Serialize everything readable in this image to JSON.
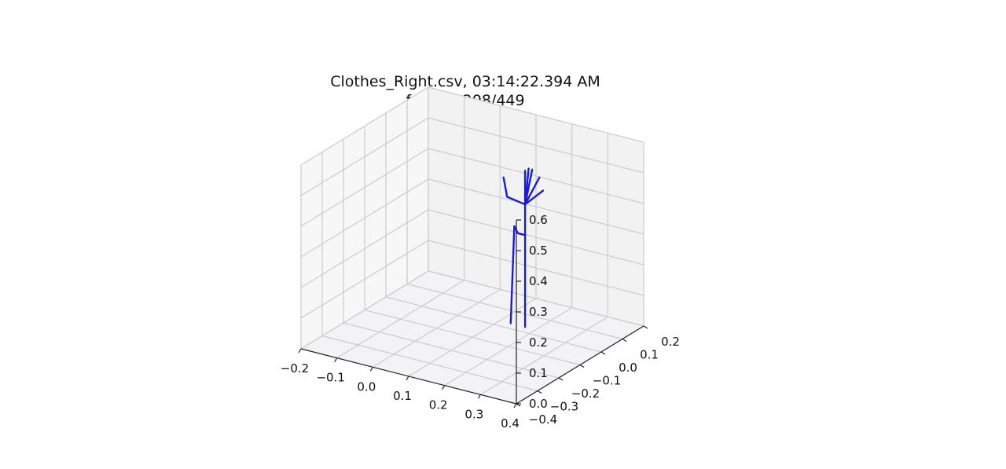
{
  "chart_data": {
    "type": "line",
    "projection": "3d",
    "title": "Clothes_Right.csv, 03:14:22.394 AM",
    "subtitle": "frame=208/449",
    "xlabel": "",
    "ylabel": "",
    "zlabel": "",
    "x_ticks": [
      "−0.2",
      "−0.1",
      "0.0",
      "0.1",
      "0.2",
      "0.3",
      "0.4"
    ],
    "y_ticks": [
      "−0.4",
      "−0.3",
      "−0.2",
      "−0.1",
      "0.0",
      "0.1",
      "0.2"
    ],
    "z_ticks": [
      "0.0",
      "0.1",
      "0.2",
      "0.3",
      "0.4",
      "0.5",
      "0.6"
    ],
    "xlim": [
      -0.2,
      0.4
    ],
    "ylim": [
      -0.4,
      0.2
    ],
    "zlim": [
      0.0,
      0.6
    ],
    "grid": true,
    "pane_color": "#f2f2f2",
    "grid_color": "#cccccc",
    "line_color": "#1a1adc",
    "series": [
      {
        "values": [
          [
            0.13,
            0.03,
            0.0
          ],
          [
            0.14,
            0.03,
            0.32
          ],
          [
            0.15,
            0.03,
            0.3
          ]
        ]
      },
      {
        "values": [
          [
            0.17,
            0.03,
            0.0
          ],
          [
            0.17,
            0.03,
            0.3
          ],
          [
            0.15,
            0.03,
            0.3
          ]
        ]
      },
      {
        "values": [
          [
            0.17,
            0.03,
            0.3
          ],
          [
            0.17,
            0.03,
            0.4
          ]
        ]
      },
      {
        "values": [
          [
            0.17,
            0.03,
            0.4
          ],
          [
            0.12,
            0.03,
            0.41
          ],
          [
            0.11,
            0.03,
            0.47
          ]
        ]
      },
      {
        "values": [
          [
            0.17,
            0.03,
            0.4
          ],
          [
            0.17,
            0.03,
            0.51
          ]
        ]
      },
      {
        "values": [
          [
            0.17,
            0.03,
            0.4
          ],
          [
            0.18,
            0.03,
            0.52
          ]
        ]
      },
      {
        "values": [
          [
            0.17,
            0.03,
            0.4
          ],
          [
            0.19,
            0.03,
            0.52
          ]
        ]
      },
      {
        "values": [
          [
            0.17,
            0.03,
            0.4
          ],
          [
            0.21,
            0.03,
            0.5
          ]
        ]
      },
      {
        "values": [
          [
            0.17,
            0.03,
            0.4
          ],
          [
            0.22,
            0.03,
            0.46
          ]
        ]
      }
    ]
  }
}
